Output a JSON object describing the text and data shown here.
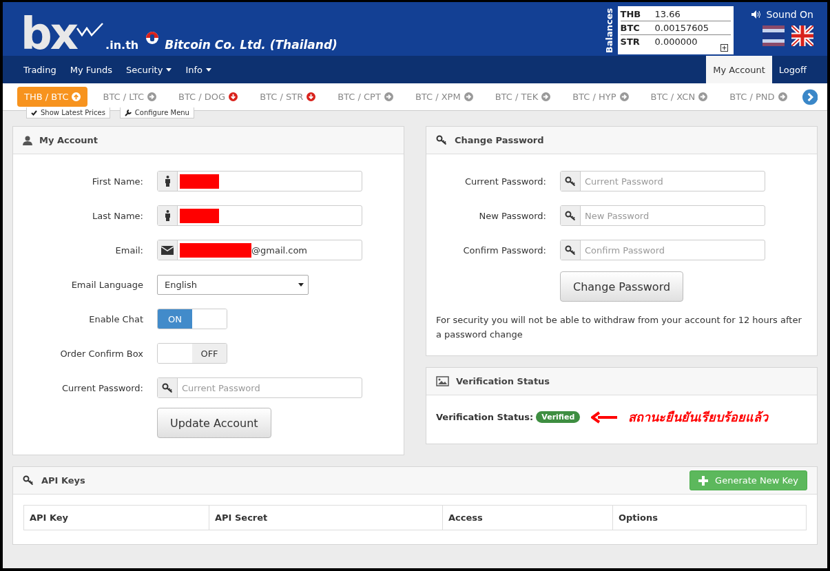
{
  "header": {
    "logo": "bx",
    "logo_suffix": ".in.th",
    "company": "Bitcoin Co. Ltd. (Thailand)",
    "balances_label": "Balances",
    "balances": [
      {
        "currency": "THB",
        "amount": "13.66"
      },
      {
        "currency": "BTC",
        "amount": "0.00157605"
      },
      {
        "currency": "STR",
        "amount": "0.000000"
      }
    ],
    "sound": "Sound On"
  },
  "nav": {
    "left": [
      {
        "label": "Trading",
        "dropdown": false
      },
      {
        "label": "My Funds",
        "dropdown": false
      },
      {
        "label": "Security",
        "dropdown": true
      },
      {
        "label": "Info",
        "dropdown": true
      }
    ],
    "right": [
      {
        "label": "My Account",
        "selected": true
      },
      {
        "label": "Logoff",
        "selected": false
      }
    ]
  },
  "pairs": [
    {
      "label": "THB / BTC",
      "kind": "up",
      "selected": true
    },
    {
      "label": "BTC / LTC",
      "kind": "right",
      "selected": false
    },
    {
      "label": "BTC / DOG",
      "kind": "down",
      "selected": false
    },
    {
      "label": "BTC / STR",
      "kind": "down",
      "selected": false
    },
    {
      "label": "BTC / CPT",
      "kind": "right",
      "selected": false
    },
    {
      "label": "BTC / XPM",
      "kind": "right",
      "selected": false
    },
    {
      "label": "BTC / TEK",
      "kind": "right",
      "selected": false
    },
    {
      "label": "BTC / HYP",
      "kind": "right",
      "selected": false
    },
    {
      "label": "BTC / XCN",
      "kind": "right",
      "selected": false
    },
    {
      "label": "BTC / PND",
      "kind": "right",
      "selected": false
    }
  ],
  "pair_options": [
    {
      "label": "Show Latest Prices",
      "kind": "check"
    },
    {
      "label": "Configure Menu",
      "kind": "wrench"
    }
  ],
  "my_account": {
    "title": "My Account",
    "fields": [
      {
        "label": "First Name:",
        "kind": "person",
        "redacted": true
      },
      {
        "label": "Last Name:",
        "kind": "person",
        "redacted": true
      },
      {
        "label": "Email:",
        "kind": "email",
        "redacted": true,
        "value": "@gmail.com"
      },
      {
        "label": "Email Language",
        "kind": "select",
        "value": "English"
      },
      {
        "label": "Enable Chat",
        "kind": "toggle",
        "on": true,
        "state_label": "ON"
      },
      {
        "label": "Order Confirm Box",
        "kind": "toggle",
        "on": false,
        "state_label": "OFF"
      },
      {
        "label": "Current Password:",
        "kind": "password",
        "placeholder": "Current Password"
      }
    ],
    "button": "Update Account"
  },
  "change_password": {
    "title": "Change Password",
    "fields": [
      {
        "label": "Current Password:",
        "placeholder": "Current Password"
      },
      {
        "label": "New Password:",
        "placeholder": "New Password"
      },
      {
        "label": "Confirm Password:",
        "placeholder": "Confirm Password"
      }
    ],
    "button": "Change Password",
    "note": "For security you will not be able to withdraw from your account for 12 hours after a password change"
  },
  "verification": {
    "title": "Verification Status",
    "label": "Verification Status:",
    "badge": "Verified",
    "annotation": "สถานะยืนยันเรียบร้อยแล้ว"
  },
  "api_keys": {
    "title": "API Keys",
    "button": "Generate New Key",
    "columns": [
      "API Key",
      "API Secret",
      "Access",
      "Options"
    ]
  }
}
